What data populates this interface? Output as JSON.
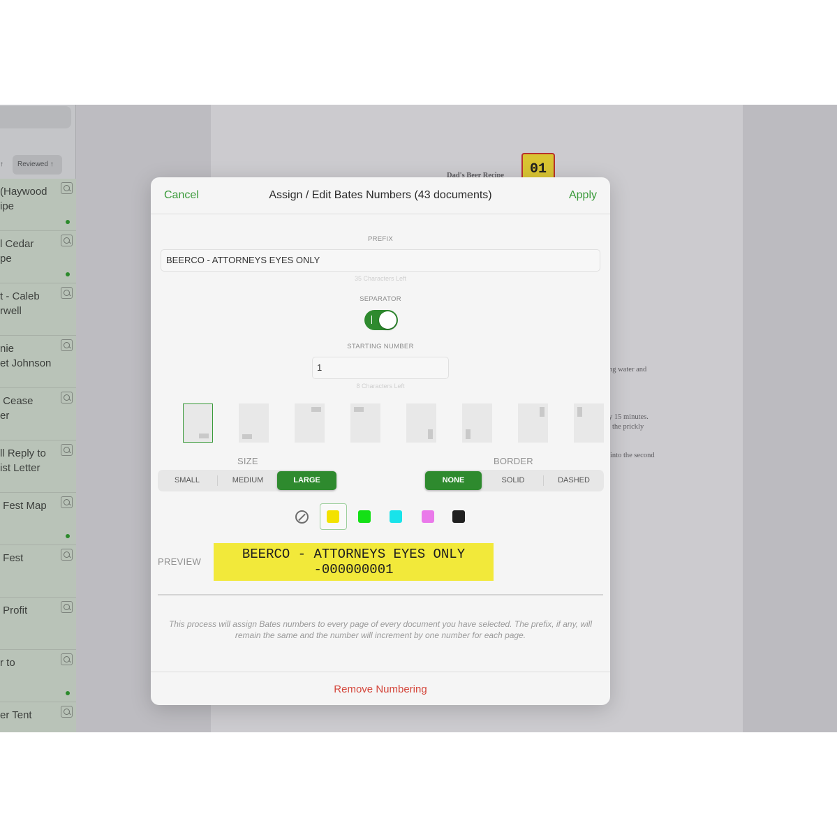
{
  "sidebar": {
    "sort_left": "↑",
    "sort_label": "Reviewed ↑",
    "items": [
      {
        "title": "(Haywood\nipe",
        "dot": true
      },
      {
        "title": "l Cedar\npe",
        "dot": true
      },
      {
        "title": "t - Caleb\nrwell",
        "dot": false
      },
      {
        "title": "nie\net Johnson",
        "dot": false
      },
      {
        "title": " Cease\ner",
        "dot": false
      },
      {
        "title": "ll Reply to\nist Letter",
        "dot": false
      },
      {
        "title": " Fest Map",
        "dot": true
      },
      {
        "title": " Fest",
        "dot": false
      },
      {
        "title": " Profit",
        "dot": false
      },
      {
        "title": "r to",
        "dot": true
      },
      {
        "title": "er Tent",
        "dot": false
      }
    ]
  },
  "background_page": {
    "title_text": "Dad's Beer Recipe",
    "stamp": "01",
    "lines": [
      "ng water and",
      "y 15 minutes.",
      "the prickly",
      "into the second"
    ]
  },
  "modal": {
    "cancel_label": "Cancel",
    "title": "Assign / Edit Bates Numbers (43 documents)",
    "apply_label": "Apply",
    "prefix_label": "PREFIX",
    "prefix_value": "BEERCO - ATTORNEYS EYES ONLY",
    "prefix_hint": "35 Characters Left",
    "separator_label": "SEPARATOR",
    "separator_on": true,
    "starting_number_label": "STARTING NUMBER",
    "starting_number_value": "1",
    "starting_number_hint": "8 Characters Left",
    "positions": [
      "bottom-right",
      "bottom-left",
      "top-right",
      "top-left",
      "right-bottom",
      "left-bottom",
      "right-top",
      "left-top"
    ],
    "selected_position": 0,
    "size_label": "SIZE",
    "size_options": [
      "SMALL",
      "MEDIUM",
      "LARGE"
    ],
    "size_selected": "LARGE",
    "border_label": "BORDER",
    "border_options": [
      "NONE",
      "SOLID",
      "DASHED"
    ],
    "border_selected": "NONE",
    "colors": [
      {
        "name": "yellow",
        "hex": "#f3e200",
        "selected": true
      },
      {
        "name": "green",
        "hex": "#14e016",
        "selected": false
      },
      {
        "name": "cyan",
        "hex": "#19e3ea",
        "selected": false
      },
      {
        "name": "magenta",
        "hex": "#ea79ea",
        "selected": false
      },
      {
        "name": "black",
        "hex": "#202020",
        "selected": false
      }
    ],
    "preview_label": "PREVIEW",
    "preview_line1": "BEERCO - ATTORNEYS EYES ONLY",
    "preview_line2": "-000000001",
    "info_text": "This process will assign Bates numbers to every page of every document you have selected. The prefix, if any, will remain the same and the number will increment by one number for each page.",
    "remove_label": "Remove Numbering"
  },
  "accent_color": "#2e8a2e",
  "destructive_color": "#d4453a"
}
